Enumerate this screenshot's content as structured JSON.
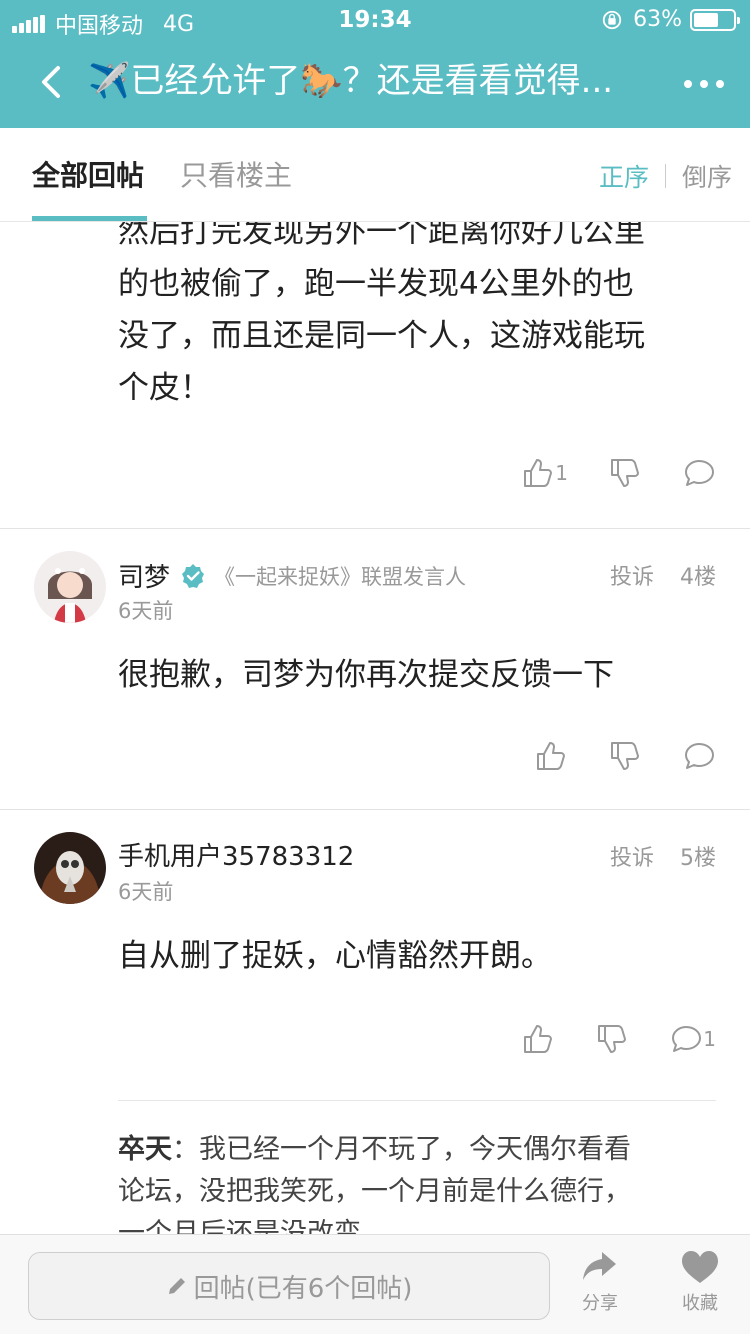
{
  "status_bar": {
    "carrier": "中国移动",
    "network": "4G",
    "time": "19:34",
    "battery": "63%",
    "battery_level": 0.63
  },
  "nav": {
    "title": "✈️已经允许了🐎？还是看看觉得...",
    "back_icon": "chevron-left-icon",
    "more_icon": "more-dots-icon"
  },
  "tabs": {
    "all": "全部回帖",
    "owner_only": "只看楼主",
    "sort_asc": "正序",
    "sort_desc": "倒序"
  },
  "floor3": {
    "text_lines": [
      "然后打完发现另外一个距离你好几公里",
      "的也被偷了，跑一半发现4公里外的也",
      "没了，而且还是同一个人，这游戏能玩",
      "个皮！"
    ],
    "likes": "1"
  },
  "floor4": {
    "username": "司梦",
    "user_title": "《一起来捉妖》联盟发言人",
    "time": "6天前",
    "report": "投诉",
    "floor": "4楼",
    "text": "很抱歉，司梦为你再次提交反馈一下"
  },
  "floor5": {
    "username": "手机用户35783312",
    "time": "6天前",
    "report": "投诉",
    "floor": "5楼",
    "text": "自从删了捉妖，心情豁然开朗。",
    "comments": "1",
    "reply": {
      "user": "卒天",
      "sep": "：",
      "lines": [
        "我已经一个月不玩了，今天偶尔看看",
        "论坛，没把我笑死，一个月前是什么德行，",
        "一个月后还是没改变......"
      ]
    }
  },
  "bottom": {
    "reply_placeholder": "回帖(已有6个回帖)",
    "share": "分享",
    "favorite": "收藏"
  },
  "colors": {
    "accent": "#5bbdc4",
    "muted": "#999999",
    "text": "#222222"
  }
}
